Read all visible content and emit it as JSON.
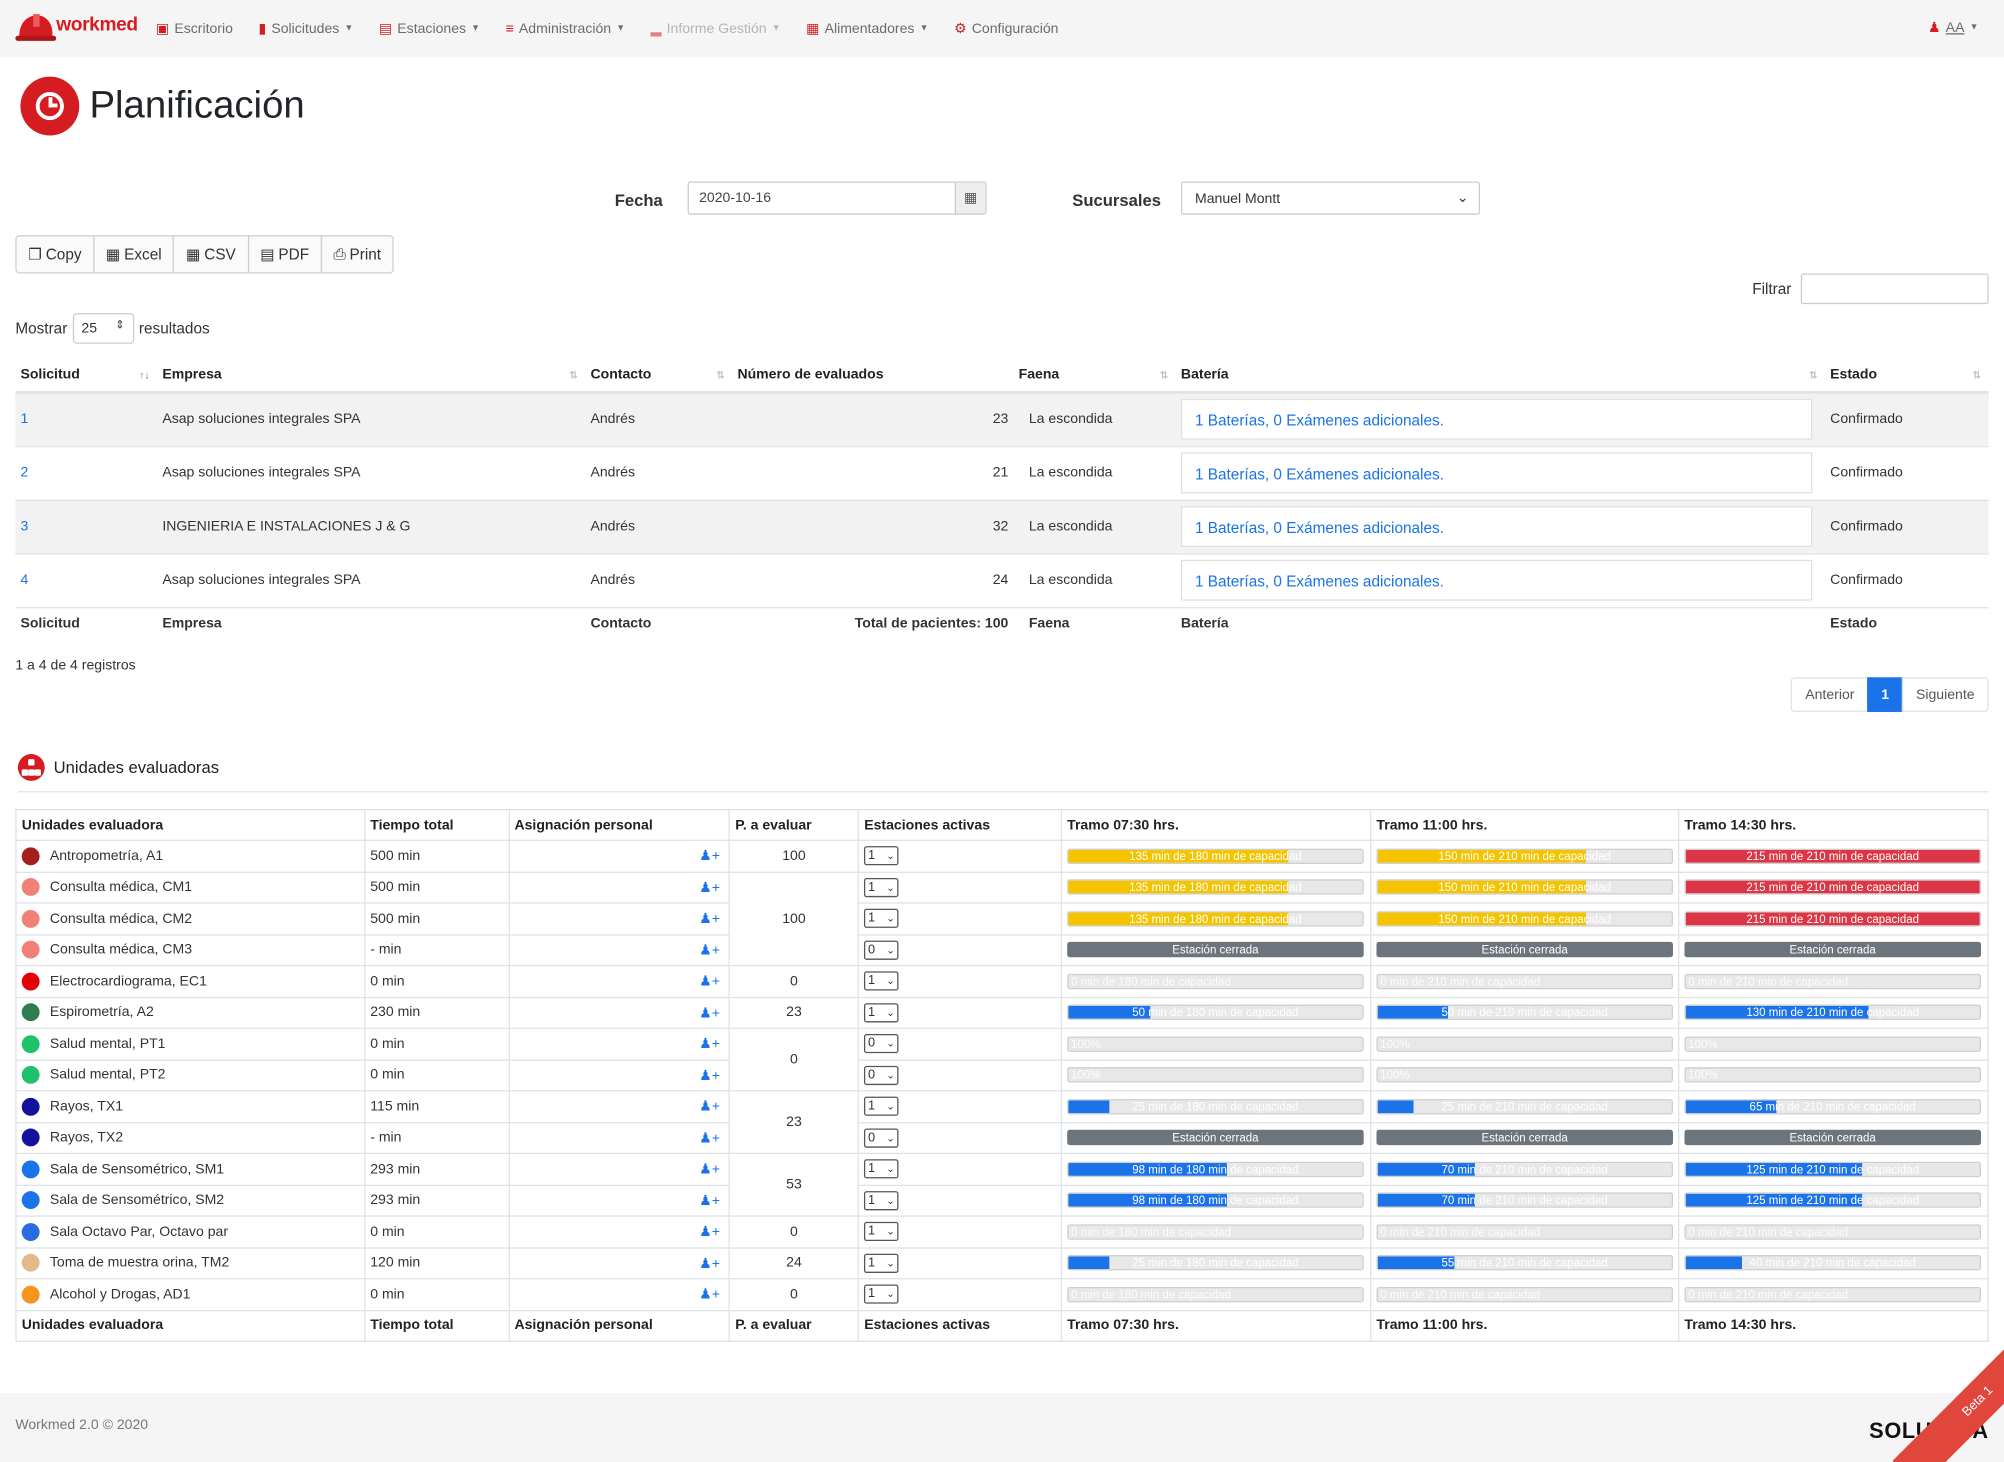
{
  "navbar": {
    "logo": "workmed",
    "items": [
      {
        "label": "Escritorio",
        "icon": "monitor-icon",
        "caret": false,
        "disabled": false
      },
      {
        "label": "Solicitudes",
        "icon": "clipboard-icon",
        "caret": true,
        "disabled": false
      },
      {
        "label": "Estaciones",
        "icon": "stations-icon",
        "caret": true,
        "disabled": false
      },
      {
        "label": "Administración",
        "icon": "list-icon",
        "caret": true,
        "disabled": false
      },
      {
        "label": "Informe Gestión",
        "icon": "chart-icon",
        "caret": true,
        "disabled": true
      },
      {
        "label": "Alimentadores",
        "icon": "database-icon",
        "caret": true,
        "disabled": false
      },
      {
        "label": "Configuración",
        "icon": "gear-icon",
        "caret": false,
        "disabled": false
      }
    ],
    "user": "AA"
  },
  "page_title": "Planificación",
  "filters": {
    "fecha_label": "Fecha",
    "fecha_value": "2020-10-16",
    "sucursales_label": "Sucursales",
    "sucursales_value": "Manuel Montt"
  },
  "export_buttons": [
    "Copy",
    "Excel",
    "CSV",
    "PDF",
    "Print"
  ],
  "filtrar_label": "Filtrar",
  "mostrar": {
    "prefix": "Mostrar",
    "value": "25",
    "suffix": "resultados"
  },
  "solicitudes": {
    "headers": [
      "Solicitud",
      "Empresa",
      "Contacto",
      "Número de evaluados",
      "Faena",
      "Batería",
      "Estado"
    ],
    "rows": [
      {
        "id": "1",
        "empresa": "Asap soluciones integrales SPA",
        "contacto": "Andrés",
        "evaluados": "23",
        "faena": "La escondida",
        "bateria": "1 Baterías, 0 Exámenes adicionales.",
        "estado": "Confirmado"
      },
      {
        "id": "2",
        "empresa": "Asap soluciones integrales SPA",
        "contacto": "Andrés",
        "evaluados": "21",
        "faena": "La escondida",
        "bateria": "1 Baterías, 0 Exámenes adicionales.",
        "estado": "Confirmado"
      },
      {
        "id": "3",
        "empresa": "INGENIERIA E INSTALACIONES J & G",
        "contacto": "Andrés",
        "evaluados": "32",
        "faena": "La escondida",
        "bateria": "1 Baterías, 0 Exámenes adicionales.",
        "estado": "Confirmado"
      },
      {
        "id": "4",
        "empresa": "Asap soluciones integrales SPA",
        "contacto": "Andrés",
        "evaluados": "24",
        "faena": "La escondida",
        "bateria": "1 Baterías, 0 Exámenes adicionales.",
        "estado": "Confirmado"
      }
    ],
    "footer": [
      "Solicitud",
      "Empresa",
      "Contacto",
      "Total de pacientes: 100",
      "Faena",
      "Batería",
      "Estado"
    ],
    "info": "1 a 4 de 4 registros",
    "pager": {
      "prev": "Anterior",
      "page": "1",
      "next": "Siguiente"
    }
  },
  "unidades": {
    "title": "Unidades evaluadoras",
    "headers": [
      "Unidades evaluadora",
      "Tiempo total",
      "Asignación personal",
      "P. a evaluar",
      "Estaciones activas",
      "Tramo 07:30 hrs.",
      "Tramo 11:00 hrs.",
      "Tramo 14:30 hrs."
    ],
    "rows": [
      {
        "name": "Antropometría, A1",
        "color": "#a5201c",
        "tiempo": "500 min",
        "pe": "100",
        "pe_span": 1,
        "est": "1",
        "t": [
          {
            "txt": "135 min de 180 min de capacidad",
            "pct": 75,
            "kind": "warn"
          },
          {
            "txt": "150 min de 210 min de capacidad",
            "pct": 71,
            "kind": "warn"
          },
          {
            "txt": "215 min de 210 min de capacidad",
            "pct": 100,
            "kind": "danger"
          }
        ]
      },
      {
        "name": "Consulta médica, CM1",
        "color": "#f08078",
        "tiempo": "500 min",
        "pe": "100",
        "pe_span": 3,
        "est": "1",
        "t": [
          {
            "txt": "135 min de 180 min de capacidad",
            "pct": 75,
            "kind": "warn"
          },
          {
            "txt": "150 min de 210 min de capacidad",
            "pct": 71,
            "kind": "warn"
          },
          {
            "txt": "215 min de 210 min de capacidad",
            "pct": 100,
            "kind": "danger"
          }
        ]
      },
      {
        "name": "Consulta médica, CM2",
        "color": "#f08078",
        "tiempo": "500 min",
        "pe": "",
        "pe_span": 0,
        "est": "1",
        "t": [
          {
            "txt": "135 min de 180 min de capacidad",
            "pct": 75,
            "kind": "warn"
          },
          {
            "txt": "150 min de 210 min de capacidad",
            "pct": 71,
            "kind": "warn"
          },
          {
            "txt": "215 min de 210 min de capacidad",
            "pct": 100,
            "kind": "danger"
          }
        ]
      },
      {
        "name": "Consulta médica, CM3",
        "color": "#f08078",
        "tiempo": "- min",
        "pe": "",
        "pe_span": 0,
        "est": "0",
        "t": [
          {
            "txt": "Estación cerrada",
            "pct": 100,
            "kind": "closed"
          },
          {
            "txt": "Estación cerrada",
            "pct": 100,
            "kind": "closed"
          },
          {
            "txt": "Estación cerrada",
            "pct": 100,
            "kind": "closed"
          }
        ]
      },
      {
        "name": "Electrocardiograma, EC1",
        "color": "#e60000",
        "tiempo": "0 min",
        "pe": "0",
        "pe_span": 1,
        "est": "1",
        "t": [
          {
            "txt": "0 min de 180 min de capacidad",
            "pct": 0,
            "kind": "info"
          },
          {
            "txt": "0 min de 210 min de capacidad",
            "pct": 0,
            "kind": "info"
          },
          {
            "txt": "0 min de 210 min de capacidad",
            "pct": 0,
            "kind": "info"
          }
        ]
      },
      {
        "name": "Espirometría, A2",
        "color": "#2e7d4f",
        "tiempo": "230 min",
        "pe": "23",
        "pe_span": 1,
        "est": "1",
        "t": [
          {
            "txt": "50 min de 180 min de capacidad",
            "pct": 28,
            "kind": "info"
          },
          {
            "txt": "50 min de 210 min de capacidad",
            "pct": 24,
            "kind": "info"
          },
          {
            "txt": "130 min de 210 min de capacidad",
            "pct": 62,
            "kind": "info"
          }
        ]
      },
      {
        "name": "Salud mental, PT1",
        "color": "#1ec26a",
        "tiempo": "0 min",
        "pe": "0",
        "pe_span": 2,
        "est": "0",
        "t": [
          {
            "txt": "100%",
            "pct": 0,
            "kind": "info"
          },
          {
            "txt": "100%",
            "pct": 0,
            "kind": "info"
          },
          {
            "txt": "100%",
            "pct": 0,
            "kind": "info"
          }
        ]
      },
      {
        "name": "Salud mental, PT2",
        "color": "#1ec26a",
        "tiempo": "0 min",
        "pe": "",
        "pe_span": 0,
        "est": "0",
        "t": [
          {
            "txt": "100%",
            "pct": 0,
            "kind": "info"
          },
          {
            "txt": "100%",
            "pct": 0,
            "kind": "info"
          },
          {
            "txt": "100%",
            "pct": 0,
            "kind": "info"
          }
        ]
      },
      {
        "name": "Rayos, TX1",
        "color": "#12129a",
        "tiempo": "115 min",
        "pe": "23",
        "pe_span": 2,
        "est": "1",
        "t": [
          {
            "txt": "25 min de 180 min de capacidad",
            "pct": 14,
            "kind": "info"
          },
          {
            "txt": "25 min de 210 min de capacidad",
            "pct": 12,
            "kind": "info"
          },
          {
            "txt": "65 min de 210 min de capacidad",
            "pct": 31,
            "kind": "info"
          }
        ]
      },
      {
        "name": "Rayos, TX2",
        "color": "#12129a",
        "tiempo": "- min",
        "pe": "",
        "pe_span": 0,
        "est": "0",
        "t": [
          {
            "txt": "Estación cerrada",
            "pct": 100,
            "kind": "closed"
          },
          {
            "txt": "Estación cerrada",
            "pct": 100,
            "kind": "closed"
          },
          {
            "txt": "Estación cerrada",
            "pct": 100,
            "kind": "closed"
          }
        ]
      },
      {
        "name": "Sala de Sensométrico, SM1",
        "color": "#1a73e8",
        "tiempo": "293 min",
        "pe": "53",
        "pe_span": 2,
        "est": "1",
        "t": [
          {
            "txt": "98 min de 180 min de capacidad",
            "pct": 54,
            "kind": "info"
          },
          {
            "txt": "70 min de 210 min de capacidad",
            "pct": 33,
            "kind": "info"
          },
          {
            "txt": "125 min de 210 min de capacidad",
            "pct": 60,
            "kind": "info"
          }
        ]
      },
      {
        "name": "Sala de Sensométrico, SM2",
        "color": "#1a73e8",
        "tiempo": "293 min",
        "pe": "",
        "pe_span": 0,
        "est": "1",
        "t": [
          {
            "txt": "98 min de 180 min de capacidad",
            "pct": 54,
            "kind": "info"
          },
          {
            "txt": "70 min de 210 min de capacidad",
            "pct": 33,
            "kind": "info"
          },
          {
            "txt": "125 min de 210 min de capacidad",
            "pct": 60,
            "kind": "info"
          }
        ]
      },
      {
        "name": "Sala Octavo Par, Octavo par",
        "color": "#2a6be0",
        "tiempo": "0 min",
        "pe": "0",
        "pe_span": 1,
        "est": "1",
        "t": [
          {
            "txt": "0 min de 180 min de capacidad",
            "pct": 0,
            "kind": "info"
          },
          {
            "txt": "0 min de 210 min de capacidad",
            "pct": 0,
            "kind": "info"
          },
          {
            "txt": "0 min de 210 min de capacidad",
            "pct": 0,
            "kind": "info"
          }
        ]
      },
      {
        "name": "Toma de muestra orina, TM2",
        "color": "#e3b98a",
        "tiempo": "120 min",
        "pe": "24",
        "pe_span": 1,
        "est": "1",
        "t": [
          {
            "txt": "25 min de 180 min de capacidad",
            "pct": 14,
            "kind": "info"
          },
          {
            "txt": "55 min de 210 min de capacidad",
            "pct": 26,
            "kind": "info"
          },
          {
            "txt": "40 min de 210 min de capacidad",
            "pct": 19,
            "kind": "info"
          }
        ]
      },
      {
        "name": "Alcohol y Drogas, AD1",
        "color": "#f7941d",
        "tiempo": "0 min",
        "pe": "0",
        "pe_span": 1,
        "est": "1",
        "t": [
          {
            "txt": "0 min de 180 min de capacidad",
            "pct": 0,
            "kind": "info"
          },
          {
            "txt": "0 min de 210 min de capacidad",
            "pct": 0,
            "kind": "info"
          },
          {
            "txt": "0 min de 210 min de capacidad",
            "pct": 0,
            "kind": "info"
          }
        ]
      }
    ]
  },
  "colors": {
    "warn": "#f5c400",
    "danger": "#dc3545",
    "info": "#1a73e8",
    "closed": "#6c757d"
  },
  "footer": {
    "text": "Workmed 2.0 © 2020",
    "brand": "SOLU    VA",
    "ribbon": "Beta 1"
  }
}
